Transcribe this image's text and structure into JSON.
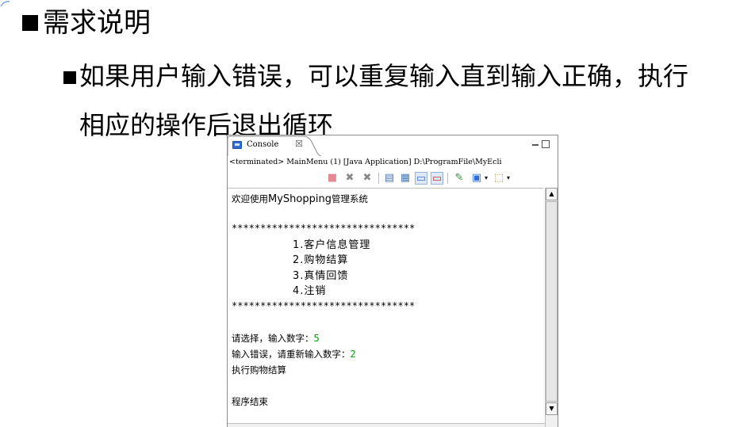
{
  "slide": {
    "heading": "需求说明",
    "bullet_line1": "如果用户输入错误，可以重复输入直到输入正确，执行",
    "bullet_line2": "相应的操作后退出循环"
  },
  "console": {
    "tab_label": "Console",
    "tab_close": "☒",
    "subtitle": "<terminated> MainMenu (1) [Java Application] D:\\ProgramFile\\MyEcli",
    "output": {
      "welcome_prefix": "欢迎使用",
      "welcome_app": "MyShopping",
      "welcome_suffix": "管理系统",
      "stars1": "********************************",
      "menu": [
        "1.客户信息管理",
        "2.购物结算",
        "3.真情回馈",
        "4.注销"
      ],
      "stars2": "********************************",
      "prompt1_label": "请选择，输入数字：",
      "prompt1_value": "5",
      "prompt2_label": "输入错误，请重新输入数字：",
      "prompt2_value": "2",
      "result": "执行购物结算",
      "end": "程序结束"
    }
  },
  "colors": {
    "input_value": "#00a000",
    "console_icon": "#2f6fd6"
  },
  "icons": {
    "toolbar": [
      "terminate-icon",
      "remove-launch-icon",
      "remove-all-icon",
      "clear-console-icon",
      "scroll-lock-icon",
      "show-on-stdout-icon",
      "show-on-stderr-icon",
      "pin-console-icon",
      "display-console-icon",
      "open-console-icon"
    ]
  }
}
